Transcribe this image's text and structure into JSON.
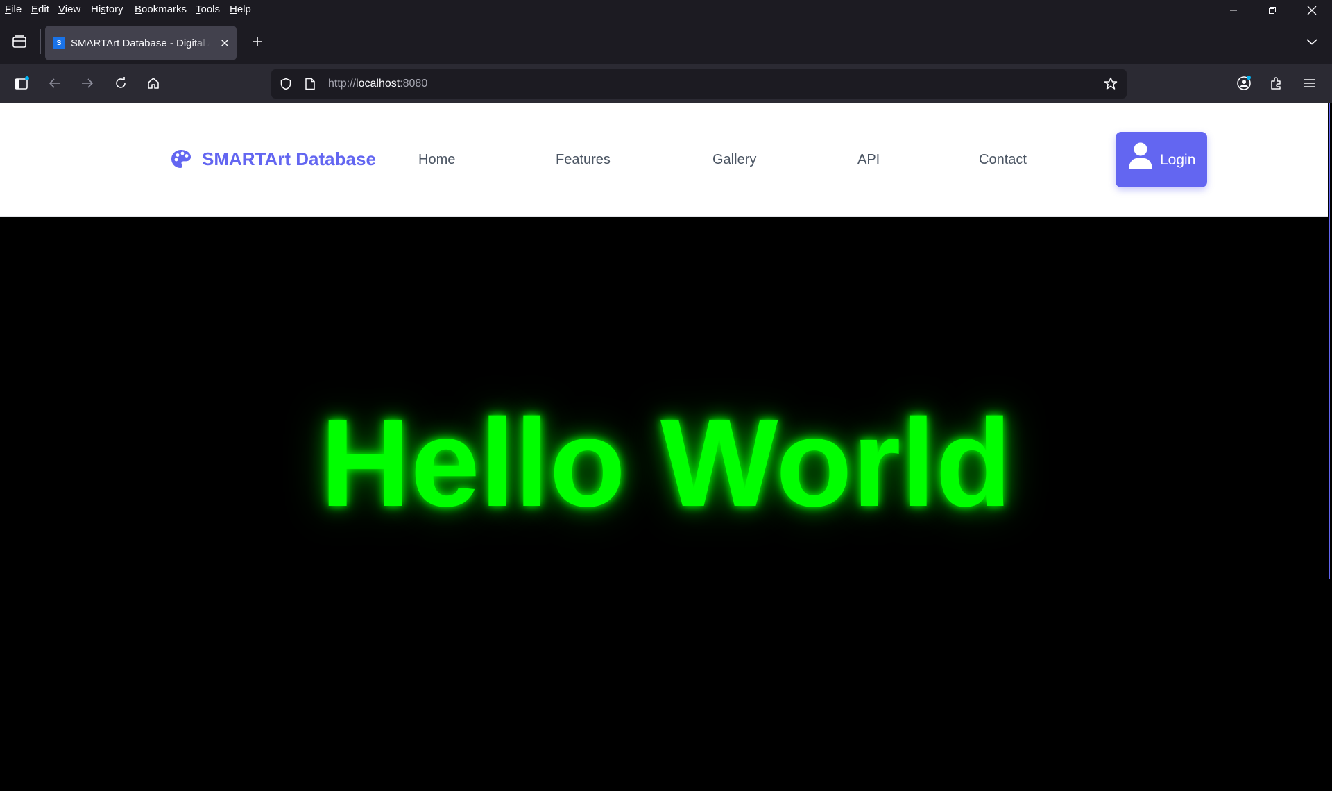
{
  "browser": {
    "menu": [
      "File",
      "Edit",
      "View",
      "History",
      "Bookmarks",
      "Tools",
      "Help"
    ],
    "menu_access_keys": [
      "F",
      "E",
      "V",
      "s",
      "B",
      "T",
      "H"
    ],
    "tab": {
      "title": "SMARTArt Database - Digital Art Database",
      "favicon_letter": "S"
    },
    "url": {
      "scheme": "http://",
      "host": "localhost",
      "port": ":8080"
    }
  },
  "site": {
    "brand": "SMARTArt Database",
    "nav": [
      "Home",
      "Features",
      "Gallery",
      "API",
      "Contact"
    ],
    "login_label": "Login",
    "hero_text": "Hello World",
    "colors": {
      "brand": "#6366f1",
      "hero": "#00ff00",
      "nav_text": "#4b5563"
    }
  }
}
